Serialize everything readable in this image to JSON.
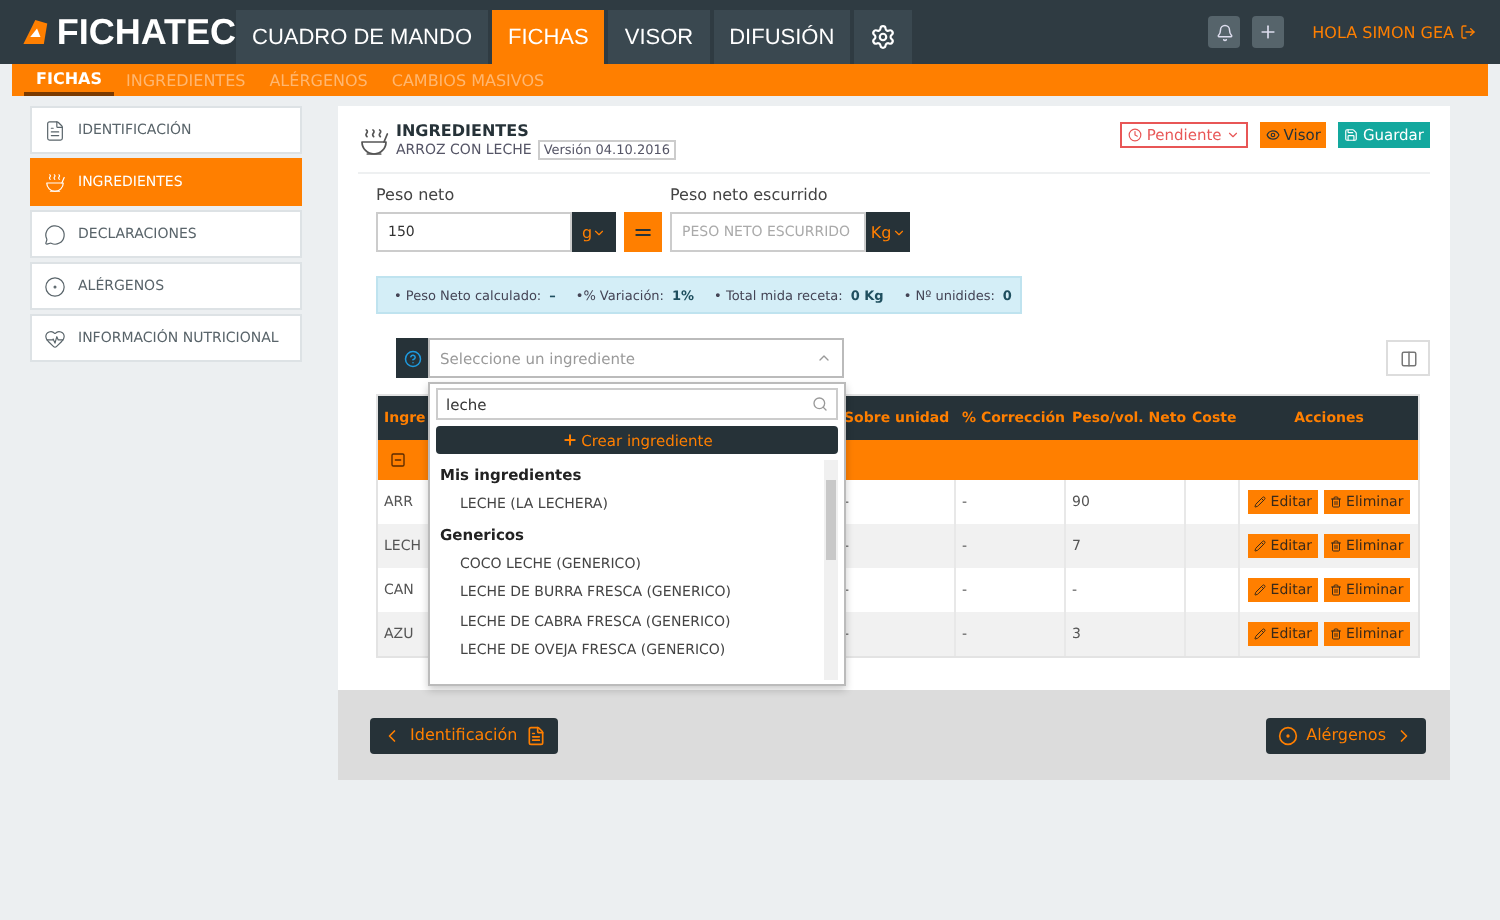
{
  "brand": {
    "part_a": "FICHA",
    "part_b": "TEC"
  },
  "nav": {
    "tabs": [
      {
        "label": "CUADRO DE MANDO",
        "selected": false
      },
      {
        "label": "FICHAS",
        "selected": true
      },
      {
        "label": "VISOR",
        "selected": false
      },
      {
        "label": "DIFUSIÓN",
        "selected": false
      }
    ],
    "user": "HOLA SIMON GEA"
  },
  "subnav": [
    {
      "label": "FICHAS",
      "selected": true
    },
    {
      "label": "INGREDIENTES",
      "selected": false
    },
    {
      "label": "ALÉRGENOS",
      "selected": false
    },
    {
      "label": "CAMBIOS MASIVOS",
      "selected": false
    }
  ],
  "sidebar": [
    {
      "label": "IDENTIFICACIÓN",
      "selected": false
    },
    {
      "label": "INGREDIENTES",
      "selected": true
    },
    {
      "label": "DECLARACIONES",
      "selected": false
    },
    {
      "label": "ALÉRGENOS",
      "selected": false
    },
    {
      "label": "INFORMACIÓN NUTRICIONAL",
      "selected": false
    }
  ],
  "panel": {
    "title": "INGREDIENTES",
    "subtitle": "ARROZ CON LECHE",
    "version": "Versión 04.10.2016",
    "status": "Pendiente",
    "buttons": [
      {
        "label": "Visor",
        "kind": "view"
      },
      {
        "label": "Guardar",
        "kind": "save"
      }
    ]
  },
  "fields": [
    {
      "label": "Peso neto",
      "value": "150",
      "unit": "g"
    },
    {
      "label": "Peso neto escurrido",
      "placeholder": "PESO NETO ESCURRIDO",
      "unit": "Kg"
    }
  ],
  "equals": "=",
  "summary": [
    {
      "label": "• Peso Neto calculado:",
      "value": "–"
    },
    {
      "label": "•% Variación:",
      "value": "1%"
    },
    {
      "label": "• Total mida receta:",
      "value": "0 Kg"
    },
    {
      "label": "• Nº unidides:",
      "value": "0"
    }
  ],
  "ingredient_select": {
    "placeholder": "Seleccione un ingrediente",
    "search": "leche",
    "create": "Crear ingrediente",
    "groups": [
      {
        "title": "Mis ingredientes",
        "items": [
          "LECHE (LA LECHERA)"
        ]
      },
      {
        "title": "Genericos",
        "items": [
          "COCO LECHE (GENERICO)",
          "LECHE DE BURRA FRESCA (GENERICO)",
          "LECHE DE CABRA FRESCA (GENERICO)",
          "LECHE DE OVEJA FRESCA (GENERICO)"
        ]
      }
    ]
  },
  "table": {
    "columns": [
      "Ingre",
      "Sobre unidad",
      "% Corrección",
      "Peso/vol. Neto",
      "Coste",
      "Acciones"
    ],
    "rows": [
      {
        "name": "ARR",
        "per_unit": "-",
        "correction": "-",
        "net_weight": "90",
        "actions": [
          "Editar",
          "Eliminar"
        ]
      },
      {
        "name": "LECH",
        "per_unit": "-",
        "correction": "-",
        "net_weight": "7",
        "actions": [
          "Editar",
          "Eliminar"
        ]
      },
      {
        "name": "CAN",
        "per_unit": "-",
        "correction": "-",
        "net_weight": "-",
        "actions": [
          "Editar",
          "Eliminar"
        ]
      },
      {
        "name": "AZU",
        "per_unit": "-",
        "correction": "-",
        "net_weight": "3",
        "actions": [
          "Editar",
          "Eliminar"
        ]
      }
    ]
  },
  "footer": {
    "previous": "Identificación",
    "next": "Alérgenos"
  }
}
